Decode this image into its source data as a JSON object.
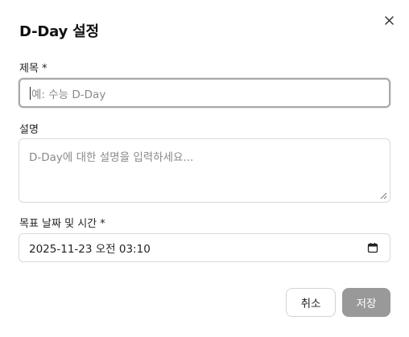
{
  "dialog": {
    "title": "D-Day 설정",
    "close_icon": "close-icon"
  },
  "fields": {
    "title": {
      "label": "제목 *",
      "value": "",
      "placeholder": "예: 수능 D-Day"
    },
    "description": {
      "label": "설명",
      "value": "",
      "placeholder": "D-Day에 대한 설명을 입력하세요..."
    },
    "datetime": {
      "label": "목표 날짜 및 시간 *",
      "value": "2025-11-23 오전 03:10",
      "icon": "calendar-icon"
    }
  },
  "buttons": {
    "cancel_label": "취소",
    "save_label": "저장"
  },
  "colors": {
    "save_button_bg": "#999999",
    "focus_border": "#a8a8a8"
  }
}
